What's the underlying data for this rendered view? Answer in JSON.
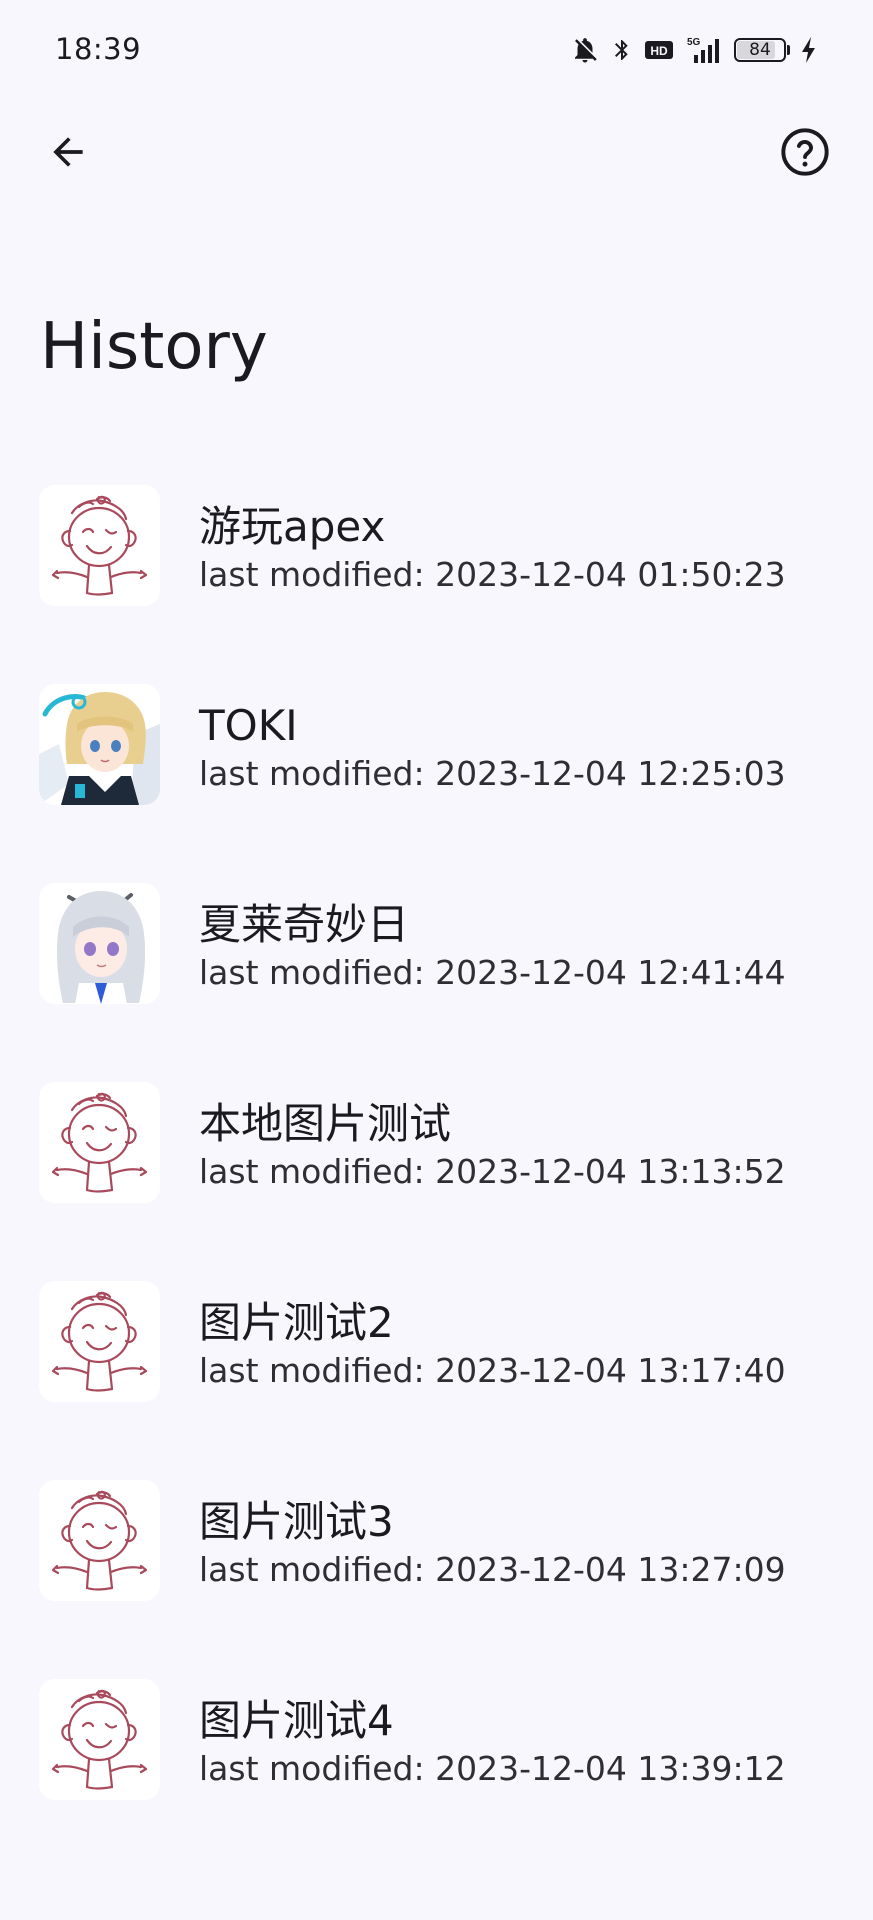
{
  "status_bar": {
    "time": "18:39",
    "battery_level": "84",
    "icons": [
      "bell-off-icon",
      "bluetooth-icon",
      "hd-icon",
      "5g-signal-icon",
      "battery-icon",
      "charging-icon"
    ]
  },
  "app_bar": {
    "back_icon": "arrow-back-icon",
    "help_icon": "help-circle-icon"
  },
  "page": {
    "title": "History"
  },
  "history": {
    "items": [
      {
        "title": "游玩apex",
        "subtitle": "last modified: 2023-12-04 01:50:23",
        "avatar": "doodle"
      },
      {
        "title": "TOKI",
        "subtitle": "last modified: 2023-12-04 12:25:03",
        "avatar": "anime-blonde"
      },
      {
        "title": "夏莱奇妙日",
        "subtitle": "last modified: 2023-12-04 12:41:44",
        "avatar": "anime-silver"
      },
      {
        "title": "本地图片测试",
        "subtitle": "last modified: 2023-12-04 13:13:52",
        "avatar": "doodle"
      },
      {
        "title": "图片测试2",
        "subtitle": "last modified: 2023-12-04 13:17:40",
        "avatar": "doodle"
      },
      {
        "title": "图片测试3",
        "subtitle": "last modified: 2023-12-04 13:27:09",
        "avatar": "doodle"
      },
      {
        "title": "图片测试4",
        "subtitle": "last modified: 2023-12-04 13:39:12",
        "avatar": "doodle"
      }
    ]
  },
  "colors": {
    "background": "#f7f7fd",
    "text": "#1b1b1f",
    "doodle_stroke": "#a84a5c"
  }
}
